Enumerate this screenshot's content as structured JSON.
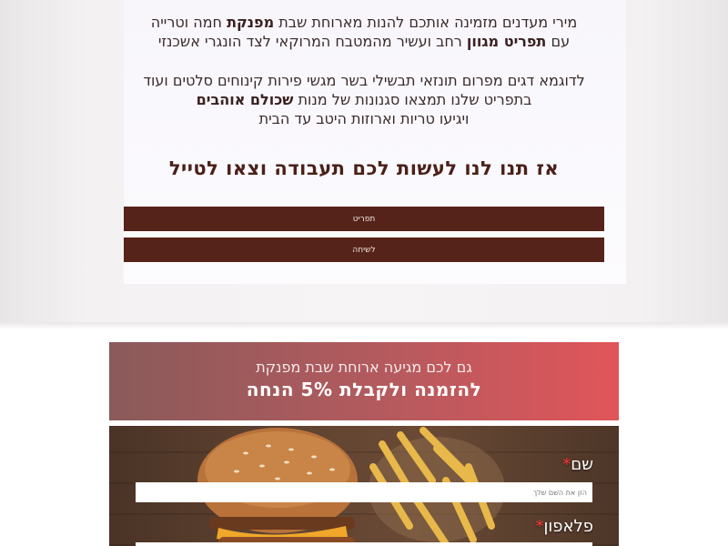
{
  "intro": {
    "p1_line1_pre": "מירי מעדנים מזמינה אותכם להנות מארוחת שבת ",
    "p1_line1_bold": "מפנקת",
    "p1_line1_post": " חמה וטרייה",
    "p1_line2_pre": "עם ",
    "p1_line2_bold": "תפריט מגוון",
    "p1_line2_post": " רחב ועשיר מהמטבח המרוקאי לצד הונגרי אשכנזי",
    "p2_line1": "לדוגמא דגים מפרום תונזאי תבשילי בשר מגשי פירות קינוחים סלטים ועוד",
    "p2_line2_pre": "בתפריט שלנו תמצאו סגנונות של מנות ",
    "p2_line2_bold": "שכולם אוהבים",
    "p2_line3": "ויגיעו טריות וארוזות היטב עד הבית"
  },
  "headline": "אז תנו לנו לעשות לכם תעבודה וצאו לטייל",
  "buttons": {
    "menu": "תפריט",
    "talk": "לשיחה"
  },
  "promo": {
    "line1": "גם לכם מגיעה ארוחת שבת מפנקת",
    "line2": "להזמנה ולקבלת 5% הנחה"
  },
  "form": {
    "name_label": "שם",
    "name_placeholder": "הזן את השם שלך",
    "phone_label": "פלאפון",
    "required_mark": "*"
  },
  "colors": {
    "button_bg": "#56231a",
    "headline": "#4a2018",
    "banner_start": "#8a5a5a",
    "banner_end": "#e0555a",
    "required": "#ff3b3b"
  }
}
